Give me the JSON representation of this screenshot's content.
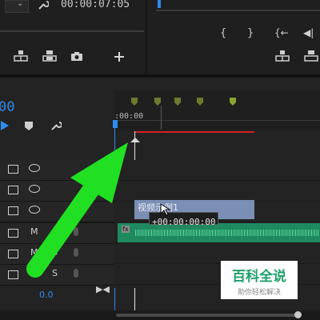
{
  "source_monitor": {
    "timecode": "00:00:07:05",
    "buttons": [
      "insert",
      "overwrite",
      "export-frame",
      "add"
    ]
  },
  "program_monitor": {
    "buttons": [
      "mark-in",
      "mark-out",
      "go-to-in",
      "step-back",
      "lift",
      "extract"
    ]
  },
  "timeline": {
    "timecode_partial": "00",
    "ruler_start": ":00:00",
    "video_tracks": [
      {
        "icon": "track-icon"
      },
      {
        "icon": "track-icon"
      },
      {
        "icon": "track-icon"
      }
    ],
    "audio_tracks": [
      {
        "m": "M",
        "s": "S"
      },
      {
        "m": "M",
        "s": "S"
      },
      {
        "m": "M",
        "s": "S"
      }
    ],
    "master_volume": "0.0",
    "clip_label": "视频示例1",
    "clip_partial": "视频",
    "tooltip": "+00:00:00:00",
    "clip_fx": "fx"
  },
  "watermark": {
    "title": "百科全说",
    "subtitle": "助你轻松解决"
  },
  "colors": {
    "accent_blue": "#2d8ceb",
    "work_area_red": "#d22323",
    "audio_clip": "#1f8a5f",
    "video_clip": "#7b8fb5",
    "arrow_green": "#21e023",
    "watermark_green": "#1fa06a"
  }
}
